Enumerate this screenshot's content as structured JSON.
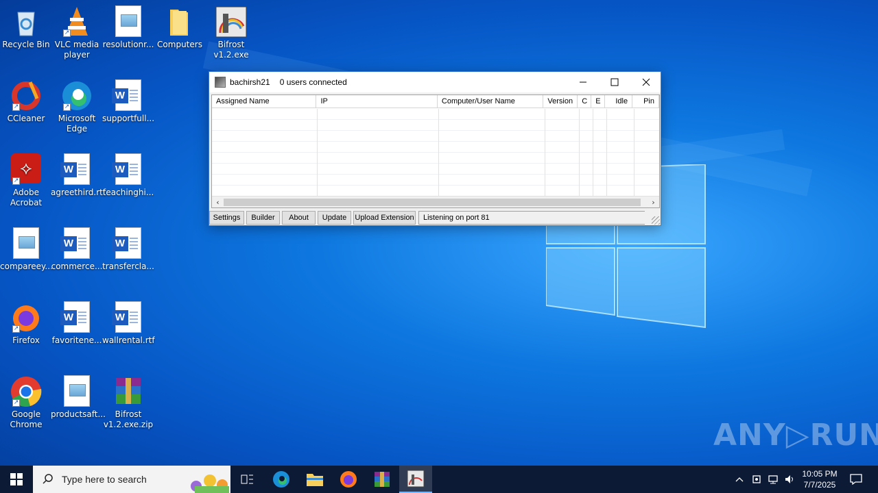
{
  "desktop": {
    "icons": [
      {
        "label": "Recycle Bin"
      },
      {
        "label": "VLC media player"
      },
      {
        "label": "resolutionr..."
      },
      {
        "label": "Computers"
      },
      {
        "label": "Bifrost v1.2.exe"
      },
      {
        "label": "CCleaner"
      },
      {
        "label": "Microsoft Edge"
      },
      {
        "label": "supportfull..."
      },
      {
        "label": "Adobe Acrobat"
      },
      {
        "label": "agreethird.rtf"
      },
      {
        "label": "teachinghi..."
      },
      {
        "label": "compareey..."
      },
      {
        "label": "commerce..."
      },
      {
        "label": "transfercla..."
      },
      {
        "label": "Firefox"
      },
      {
        "label": "favoritene..."
      },
      {
        "label": "wallrental.rtf"
      },
      {
        "label": "Google Chrome"
      },
      {
        "label": "productsaft..."
      },
      {
        "label": "Bifrost v1.2.exe.zip"
      }
    ],
    "watermark": "ANY▷RUN"
  },
  "window": {
    "title": "bachirsh21",
    "subtitle": "0 users connected",
    "columns": [
      "Assigned Name",
      "IP",
      "Computer/User Name",
      "Version",
      "C",
      "E",
      "Idle",
      "Pin"
    ],
    "buttons": {
      "settings": "Settings",
      "builder": "Builder",
      "about": "About",
      "update": "Update",
      "upload_extension": "Upload Extension"
    },
    "status": "Listening on port 81"
  },
  "taskbar": {
    "search_placeholder": "Type here to search",
    "time": "10:05 PM",
    "date": "7/7/2025"
  }
}
